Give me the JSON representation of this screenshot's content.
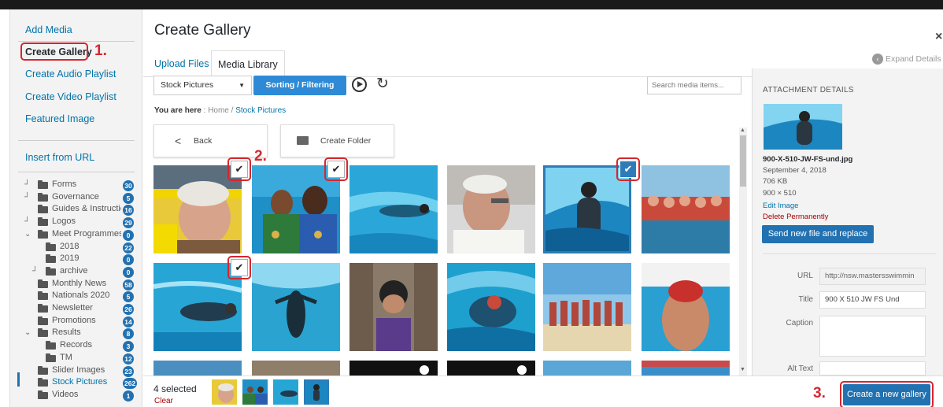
{
  "menu": {
    "items": [
      {
        "label": "Add Media"
      },
      {
        "label": "Create Gallery"
      },
      {
        "label": "Create Audio Playlist"
      },
      {
        "label": "Create Video Playlist"
      },
      {
        "label": "Featured Image"
      },
      {
        "label": "Insert from URL"
      }
    ]
  },
  "annotations": {
    "step1": "1.",
    "step2": "2.",
    "step3": "3."
  },
  "tree": [
    {
      "label": "Forms",
      "badge": "30",
      "expander": "┘"
    },
    {
      "label": "Governance",
      "badge": "5",
      "expander": "┘"
    },
    {
      "label": "Guides & Instructions",
      "badge": "16",
      "expander": ""
    },
    {
      "label": "Logos",
      "badge": "29",
      "expander": "┘"
    },
    {
      "label": "Meet Programmes",
      "badge": "0",
      "expander": "⌄"
    },
    {
      "label": "2018",
      "badge": "22",
      "expander": ""
    },
    {
      "label": "2019",
      "badge": "0",
      "expander": ""
    },
    {
      "label": "archive",
      "badge": "0",
      "expander": "┘"
    },
    {
      "label": "Monthly News",
      "badge": "58",
      "expander": ""
    },
    {
      "label": "Nationals 2020",
      "badge": "5",
      "expander": ""
    },
    {
      "label": "Newsletter",
      "badge": "26",
      "expander": ""
    },
    {
      "label": "Promotions",
      "badge": "14",
      "expander": ""
    },
    {
      "label": "Results",
      "badge": "8",
      "expander": "⌄"
    },
    {
      "label": "Records",
      "badge": "3",
      "expander": ""
    },
    {
      "label": "TM",
      "badge": "12",
      "expander": ""
    },
    {
      "label": "Slider Images",
      "badge": "23",
      "expander": ""
    },
    {
      "label": "Stock Pictures",
      "badge": "262",
      "expander": ""
    },
    {
      "label": "Videos",
      "badge": "1",
      "expander": ""
    }
  ],
  "header": {
    "title": "Create Gallery",
    "close": "×",
    "tabs": [
      "Upload Files",
      "Media Library"
    ],
    "expand": "Expand Details"
  },
  "toolbar": {
    "folder_select": "Stock Pictures",
    "sort_button": "Sorting / Filtering",
    "search_placeholder": "Search media items..."
  },
  "breadcrumb": {
    "prefix": "You are here",
    "home": "Home",
    "current": "Stock Pictures"
  },
  "folder_buttons": {
    "back": "Back",
    "create": "Create Folder"
  },
  "attachment": {
    "heading": "ATTACHMENT DETAILS",
    "filename": "900-X-510-JW-FS-und.jpg",
    "date": "September 4, 2018",
    "size": "706 KB",
    "dimensions": "900 × 510",
    "edit": "Edit Image",
    "delete": "Delete Permanently",
    "replace": "Send new file and replace",
    "fields": [
      {
        "label": "URL",
        "value": "http://nsw.mastersswimmin"
      },
      {
        "label": "Title",
        "value": "900 X 510 JW FS Und"
      },
      {
        "label": "Caption",
        "value": ""
      },
      {
        "label": "Alt Text",
        "value": ""
      }
    ]
  },
  "footer": {
    "selected": "4 selected",
    "clear": "Clear",
    "create_gallery": "Create a new gallery"
  },
  "colors": {
    "accent": "#2271b1",
    "annotation": "#d6262e"
  }
}
